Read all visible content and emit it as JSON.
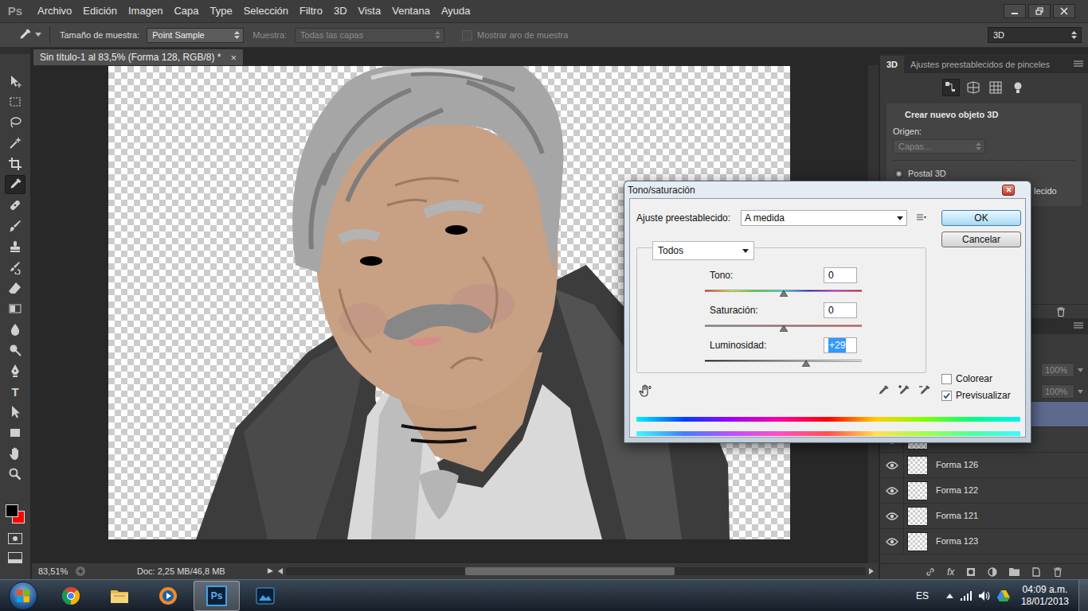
{
  "app": {
    "logo": "Ps"
  },
  "menu": [
    "Archivo",
    "Edición",
    "Imagen",
    "Capa",
    "Type",
    "Selección",
    "Filtro",
    "3D",
    "Vista",
    "Ventana",
    "Ayuda"
  ],
  "options_bar": {
    "sample_size_label": "Tamaño de muestra:",
    "sample_size": "Point Sample",
    "sample_label": "Muestra:",
    "sample": "Todas las capas",
    "sample_disabled": true,
    "ring_label": "Mostrar aro de muestra",
    "ring_checked": false,
    "ring_disabled": true,
    "workspace": "3D"
  },
  "tools": [
    {
      "kind": "move",
      "selected": false
    },
    {
      "kind": "marquee",
      "selected": false
    },
    {
      "kind": "lasso",
      "selected": false
    },
    {
      "kind": "wand",
      "selected": false
    },
    {
      "kind": "crop",
      "selected": false
    },
    {
      "kind": "eyedropper",
      "selected": true
    },
    {
      "kind": "heal",
      "selected": false
    },
    {
      "kind": "brush",
      "selected": false
    },
    {
      "kind": "stamp",
      "selected": false
    },
    {
      "kind": "history",
      "selected": false
    },
    {
      "kind": "eraser",
      "selected": false
    },
    {
      "kind": "gradient",
      "selected": false
    },
    {
      "kind": "blur",
      "selected": false
    },
    {
      "kind": "dodge",
      "selected": false
    },
    {
      "kind": "pen",
      "selected": false
    },
    {
      "kind": "type",
      "label": "T",
      "selected": false
    },
    {
      "kind": "path",
      "selected": false
    },
    {
      "kind": "shape",
      "selected": false
    },
    {
      "kind": "hand",
      "selected": false
    },
    {
      "kind": "zoom",
      "selected": false
    }
  ],
  "document": {
    "tab": "Sin título-1 al 83,5% (Forma 128, RGB/8) *",
    "close": "×"
  },
  "status_bar": {
    "zoom": "83,51%",
    "doc": "Doc: 2,25 MB/46,8 MB",
    "menu_arrow": "▶"
  },
  "panel_3d": {
    "tabs": [
      {
        "label": "3D",
        "selected": true
      },
      {
        "label": "Ajustes preestablecidos de pinceles",
        "selected": false
      }
    ],
    "views": [
      {
        "kind": "scene",
        "selected": true
      },
      {
        "kind": "mesh",
        "selected": false
      },
      {
        "kind": "material",
        "selected": false
      },
      {
        "kind": "light",
        "selected": false
      }
    ],
    "title": "Crear nuevo objeto 3D",
    "source_label": "Origen:",
    "source": "Capas...",
    "source_disabled": true,
    "options": [
      {
        "label": "Postal 3D",
        "selected": true
      }
    ],
    "cut_label": "lecido"
  },
  "layers": {
    "opacity": {
      "value": "100%",
      "disabled": true
    },
    "fill": {
      "value": "100%",
      "disabled": true
    },
    "fx": "fx",
    "rows": [
      {
        "selected": true,
        "visible": true
      },
      {
        "selected": false,
        "visible": true
      },
      {
        "name": "Forma 126",
        "selected": false,
        "visible": true
      },
      {
        "name": "Forma 122",
        "selected": false,
        "visible": true
      },
      {
        "name": "Forma 121",
        "selected": false,
        "visible": true
      },
      {
        "name": "Forma 123",
        "selected": false,
        "visible": true
      }
    ]
  },
  "dialog": {
    "title": "Tono/saturación",
    "preset_label": "Ajuste preestablecido:",
    "preset": "A medida",
    "ok": "OK",
    "cancel": "Cancelar",
    "channel": "Todos",
    "sliders": [
      {
        "kind": "hue",
        "label": "Tono:",
        "value": "0",
        "level": 0.5,
        "focused": false
      },
      {
        "kind": "saturation",
        "label": "Saturación:",
        "value": "0",
        "level": 0.5,
        "focused": false
      },
      {
        "kind": "lightness",
        "label": "Luminosidad:",
        "value": "+29",
        "level": 0.645,
        "focused": true
      }
    ],
    "colorize": {
      "label": "Colorear",
      "checked": false
    },
    "preview": {
      "label": "Previsualizar",
      "checked": true
    }
  },
  "taskbar": {
    "apps": [
      {
        "kind": "chrome",
        "selected": false
      },
      {
        "kind": "explorer",
        "selected": false
      },
      {
        "kind": "media",
        "selected": false
      },
      {
        "kind": "photoshop",
        "label": "Ps",
        "selected": true
      },
      {
        "kind": "app",
        "selected": false
      }
    ],
    "language": "ES",
    "time": "04:09 a.m.",
    "date": "18/01/2013"
  }
}
